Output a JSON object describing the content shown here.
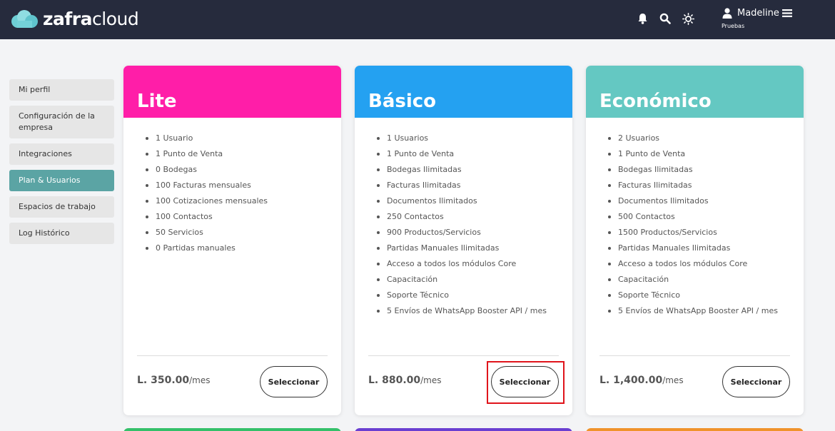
{
  "brand": {
    "part1": "zafra",
    "part2": "cloud",
    "cloud_color": "#6ecfd6"
  },
  "header": {
    "icons": [
      "bell-icon",
      "search-icon",
      "sun-icon"
    ],
    "user_name": "Madeline",
    "user_subtitle": "Pruebas"
  },
  "sidebar": {
    "items": [
      {
        "label": "Mi perfil",
        "active": false
      },
      {
        "label": "Configuración de la empresa",
        "active": false
      },
      {
        "label": "Integraciones",
        "active": false
      },
      {
        "label": "Plan & Usuarios",
        "active": true
      },
      {
        "label": "Espacios de trabajo",
        "active": false
      },
      {
        "label": "Log Histórico",
        "active": false
      }
    ]
  },
  "plans": [
    {
      "name": "Lite",
      "color": "#ff1ea8",
      "features": [
        "1 Usuario",
        "1 Punto de Venta",
        "0 Bodegas",
        "100 Facturas mensuales",
        "100 Cotizaciones mensuales",
        "100 Contactos",
        "50 Servicios",
        "0 Partidas manuales"
      ],
      "price": "L. 350.00",
      "period": "/mes",
      "button": "Seleccionar"
    },
    {
      "name": "Básico",
      "color": "#24a1f1",
      "features": [
        "1 Usuarios",
        "1 Punto de Venta",
        "Bodegas Ilimitadas",
        "Facturas Ilimitadas",
        "Documentos Ilimitados",
        "250 Contactos",
        "900 Productos/Servicios",
        "Partidas Manuales Ilimitadas",
        "Acceso a todos los módulos Core",
        "Capacitación",
        "Soporte Técnico",
        "5 Envíos de WhatsApp Booster API / mes"
      ],
      "price": "L. 880.00",
      "period": "/mes",
      "button": "Seleccionar"
    },
    {
      "name": "Económico",
      "color": "#64c8c2",
      "features": [
        "2 Usuarios",
        "1 Punto de Venta",
        "Bodegas Ilimitadas",
        "Facturas Ilimitadas",
        "Documentos Ilimitados",
        "500 Contactos",
        "1500 Productos/Servicios",
        "Partidas Manuales Ilimitadas",
        "Acceso a todos los módulos Core",
        "Capacitación",
        "Soporte Técnico",
        "5 Envíos de WhatsApp Booster API / mes"
      ],
      "price": "L. 1,400.00",
      "period": "/mes",
      "button": "Seleccionar"
    }
  ],
  "peek_colors": [
    "#34c06a",
    "#6a3fd1",
    "#f0932b"
  ],
  "highlight_color": "#e0141b"
}
